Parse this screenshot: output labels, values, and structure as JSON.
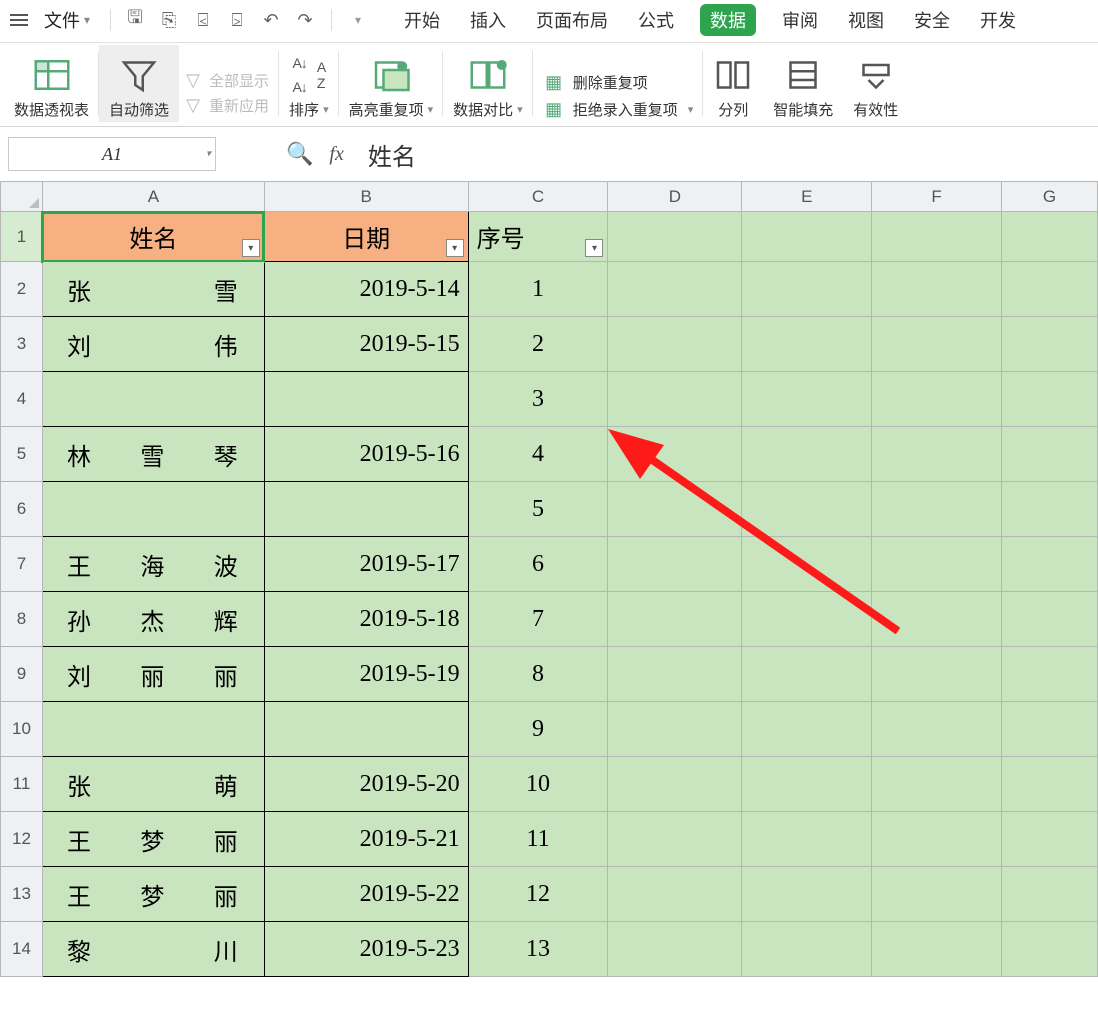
{
  "menubar": {
    "file_label": "文件",
    "qat_tips": [
      "保存",
      "打印",
      "预览",
      "输出",
      "撤销",
      "重做",
      "更多"
    ]
  },
  "tabs": {
    "items": [
      "开始",
      "插入",
      "页面布局",
      "公式",
      "数据",
      "审阅",
      "视图",
      "安全",
      "开发"
    ],
    "active_index": 4
  },
  "ribbon": {
    "pivot": "数据透视表",
    "autofilter": "自动筛选",
    "show_all": "全部显示",
    "reapply": "重新应用",
    "sort": "排序",
    "highlight_dup": "高亮重复项",
    "data_compare": "数据对比",
    "remove_dup": "删除重复项",
    "reject_dup": "拒绝录入重复项",
    "text_to_cols": "分列",
    "smart_fill": "智能填充",
    "validity": "有效性"
  },
  "namebox": {
    "ref": "A1"
  },
  "formula": {
    "value": "姓名"
  },
  "columns": [
    "A",
    "B",
    "C",
    "D",
    "E",
    "F",
    "G"
  ],
  "grid": {
    "header": {
      "name": "姓名",
      "date": "日期",
      "seq": "序号"
    },
    "rows": [
      {
        "n": 1,
        "name": "",
        "date": "",
        "seq": ""
      },
      {
        "n": 2,
        "name": "张雪",
        "date": "2019-5-14",
        "seq": "1"
      },
      {
        "n": 3,
        "name": "刘伟",
        "date": "2019-5-15",
        "seq": "2"
      },
      {
        "n": 4,
        "name": "",
        "date": "",
        "seq": "3"
      },
      {
        "n": 5,
        "name": "林雪琴",
        "date": "2019-5-16",
        "seq": "4"
      },
      {
        "n": 6,
        "name": "",
        "date": "",
        "seq": "5"
      },
      {
        "n": 7,
        "name": "王海波",
        "date": "2019-5-17",
        "seq": "6"
      },
      {
        "n": 8,
        "name": "孙杰辉",
        "date": "2019-5-18",
        "seq": "7"
      },
      {
        "n": 9,
        "name": "刘丽丽",
        "date": "2019-5-19",
        "seq": "8"
      },
      {
        "n": 10,
        "name": "",
        "date": "",
        "seq": "9"
      },
      {
        "n": 11,
        "name": "张萌",
        "date": "2019-5-20",
        "seq": "10"
      },
      {
        "n": 12,
        "name": "王梦丽",
        "date": "2019-5-21",
        "seq": "11"
      },
      {
        "n": 13,
        "name": "王梦丽",
        "date": "2019-5-22",
        "seq": "12"
      },
      {
        "n": 14,
        "name": "黎川",
        "date": "2019-5-23",
        "seq": "13"
      }
    ]
  }
}
